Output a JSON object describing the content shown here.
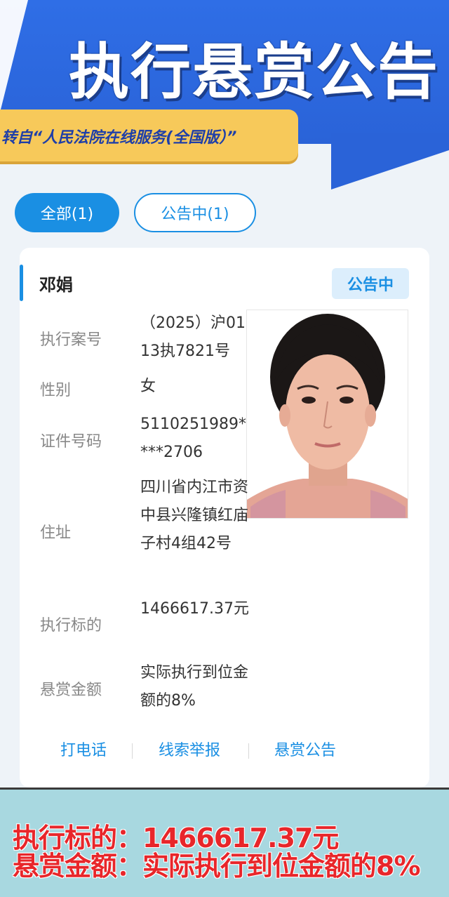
{
  "header": {
    "title": "执行悬赏公告",
    "source": "转自“人民法院在线服务(全国版）”"
  },
  "filters": {
    "all": "全部(1)",
    "notice": "公告中(1)"
  },
  "card": {
    "name": "邓娟",
    "status": "公告中",
    "fields": [
      {
        "label": "执行案号",
        "value": "（2025）沪0113执7821号"
      },
      {
        "label": "性别",
        "value": "女"
      },
      {
        "label": "证件号码",
        "value": "5110251989****2706"
      },
      {
        "label": "住址",
        "value": "四川省内江市资中县兴隆镇红庙子村4组42号"
      },
      {
        "label": "执行标的",
        "value": "1466617.37元"
      },
      {
        "label": "悬赏金额",
        "value": "实际执行到位金额的8%"
      }
    ],
    "actions": {
      "call": "打电话",
      "report": "线索举报",
      "bounty": "悬赏公告"
    }
  },
  "caption": {
    "line1": "执行标的：1466617.37元",
    "line2": "悬赏金额：实际执行到位金额的8%"
  },
  "colors": {
    "brand_blue": "#1a8fe3",
    "banner_blue": "#2a63d8",
    "source_yellow": "#f7c95a",
    "caption_red": "#e8262a",
    "caption_bg": "#a8d8e0"
  }
}
